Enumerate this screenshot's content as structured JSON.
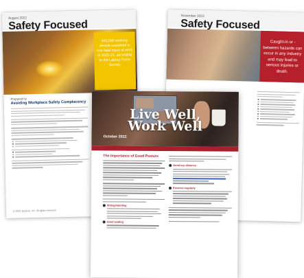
{
  "left_page": {
    "date": "August 2022",
    "title": "Safety Focused",
    "callout": "443,000 working people sustained a non-fatal injury at work in 2020-21, according to the Labour Force Survey.",
    "prepared_by": "Prepared by",
    "article_title": "Avoiding Workplace Safety Complacency",
    "copyright": "© 2022 Zywave, Inc. All rights reserved."
  },
  "right_page": {
    "date": "November 2022",
    "title": "Safety Focused",
    "callout": "Caught-in or -between hazards can occur in any industry and may lead to serious injuries or death."
  },
  "center_page": {
    "title_line1": "Live Well,",
    "title_line2": "Work Well",
    "date": "October 2022",
    "section_title": "The Importance of Good Posture",
    "tip_1": "Sitting/standing",
    "tip_2": "Good seating",
    "tip_3": "Good eye distance",
    "tip_4": "Exercise regularly"
  },
  "colors": {
    "safety_yellow": "#f3c400",
    "safety_red": "#b5202a",
    "wellness_red": "#a91f2e",
    "navy_heading": "#0b2f68"
  }
}
